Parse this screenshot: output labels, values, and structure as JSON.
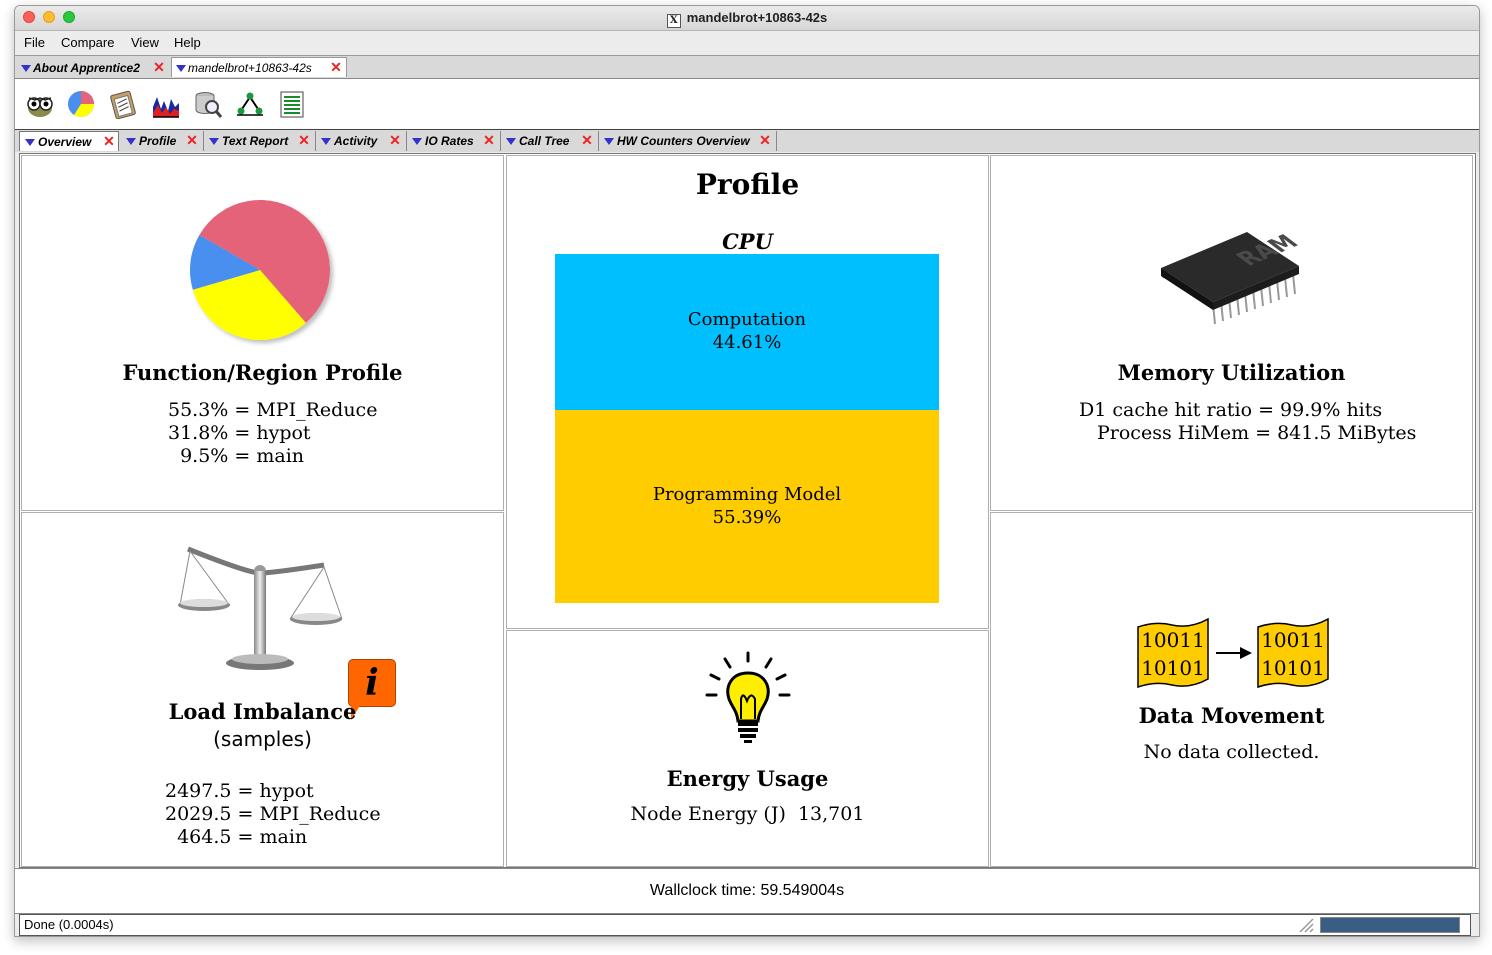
{
  "window": {
    "title": "mandelbrot+10863-42s",
    "title_icon": "X"
  },
  "menubar": {
    "items": [
      "File",
      "Compare",
      "View",
      "Help"
    ]
  },
  "top_tabs": [
    {
      "label": "About Apprentice2"
    },
    {
      "label": "mandelbrot+10863-42s"
    }
  ],
  "toolbar": {
    "icons": [
      "owl-icon",
      "pie-chart-icon",
      "clipboard-icon",
      "histogram-icon",
      "database-search-icon",
      "call-tree-icon",
      "report-list-icon"
    ]
  },
  "view_tabs": [
    {
      "label": "Overview"
    },
    {
      "label": "Profile"
    },
    {
      "label": "Text Report"
    },
    {
      "label": "Activity"
    },
    {
      "label": "IO Rates"
    },
    {
      "label": "Call Tree"
    },
    {
      "label": "HW Counters Overview"
    }
  ],
  "function_profile": {
    "title": "Function/Region Profile",
    "lines": [
      "55.3% = MPI_Reduce",
      "31.8% = hypot",
      "  9.5% = main"
    ],
    "pie_values": [
      55.3,
      31.8,
      12.9
    ],
    "pie_colors": [
      "#e46478",
      "#ffff00",
      "#4a8ff0"
    ]
  },
  "profile": {
    "title": "Profile",
    "subtitle": "CPU",
    "computation_label": "Computation",
    "computation_value": "44.61%",
    "programming_label": "Programming Model",
    "programming_value": "55.39%",
    "computation_color": "#00bfff",
    "programming_color": "#ffcc00"
  },
  "memory": {
    "title": "Memory Utilization",
    "line1": "D1 cache hit ratio = 99.9% hits",
    "line2": "Process HiMem = 841.5 MiBytes",
    "chip_text": "RAM"
  },
  "load_imbalance": {
    "title": "Load Imbalance",
    "subtitle": "(samples)",
    "lines": [
      "2497.5 = hypot",
      "2029.5 = MPI_Reduce",
      "  464.5 = main"
    ],
    "info_glyph": "i"
  },
  "energy": {
    "title": "Energy Usage",
    "line": "Node Energy (J)  13,701"
  },
  "data_movement": {
    "title": "Data Movement",
    "line": "No data collected.",
    "bits_top": "10011",
    "bits_bottom": "10101"
  },
  "footer": {
    "wallclock": "Wallclock time: 59.549004s"
  },
  "status": {
    "text": "Done (0.0004s)"
  }
}
